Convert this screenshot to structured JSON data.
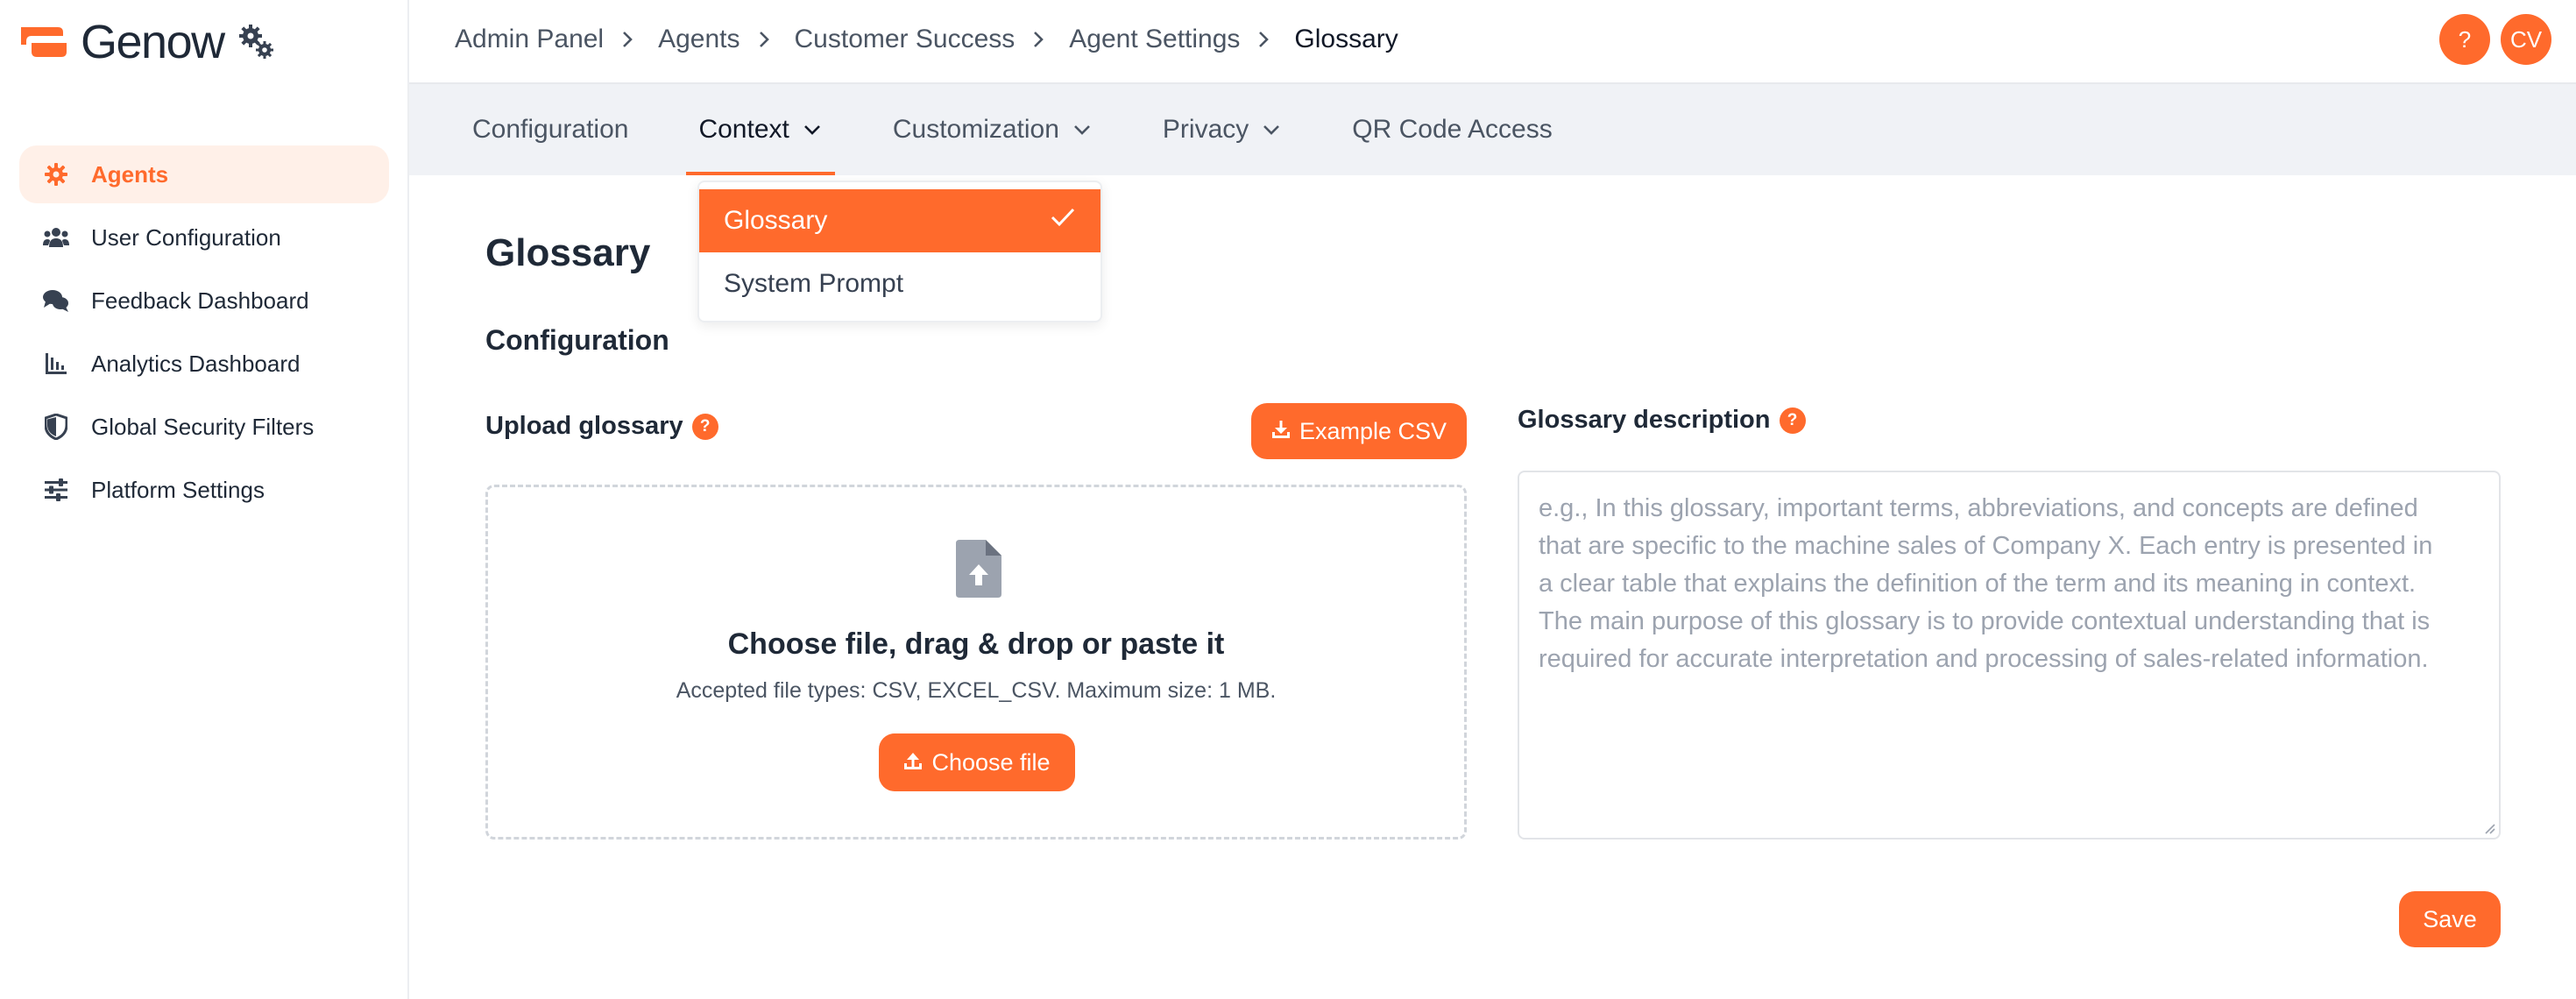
{
  "app": {
    "name": "Genow"
  },
  "sidebar": {
    "items": [
      {
        "label": "Agents",
        "icon": "gear-icon",
        "active": true
      },
      {
        "label": "User Configuration",
        "icon": "users-icon",
        "active": false
      },
      {
        "label": "Feedback Dashboard",
        "icon": "chat-bubbles-icon",
        "active": false
      },
      {
        "label": "Analytics Dashboard",
        "icon": "bar-chart-icon",
        "active": false
      },
      {
        "label": "Global Security Filters",
        "icon": "shield-icon",
        "active": false
      },
      {
        "label": "Platform Settings",
        "icon": "sliders-icon",
        "active": false
      }
    ]
  },
  "breadcrumb": [
    "Admin Panel",
    "Agents",
    "Customer Success",
    "Agent Settings",
    "Glossary"
  ],
  "header": {
    "help_label": "?",
    "avatar_initials": "CV"
  },
  "tabs": [
    {
      "label": "Configuration",
      "has_dropdown": false,
      "active": false
    },
    {
      "label": "Context",
      "has_dropdown": true,
      "active": true
    },
    {
      "label": "Customization",
      "has_dropdown": true,
      "active": false
    },
    {
      "label": "Privacy",
      "has_dropdown": true,
      "active": false
    },
    {
      "label": "QR Code Access",
      "has_dropdown": false,
      "active": false
    }
  ],
  "context_menu": {
    "items": [
      {
        "label": "Glossary",
        "selected": true
      },
      {
        "label": "System Prompt",
        "selected": false
      }
    ]
  },
  "main": {
    "title": "Glossary",
    "section_title": "Configuration",
    "upload": {
      "label": "Upload glossary",
      "help": "?",
      "example_button": "Example CSV",
      "drop_title": "Choose file, drag & drop or paste it",
      "drop_hint": "Accepted file types: CSV, EXCEL_CSV. Maximum size: 1 MB.",
      "choose_button": "Choose file"
    },
    "description": {
      "label": "Glossary description",
      "help": "?",
      "placeholder_lines": [
        "e.g., In this glossary, important terms, abbreviations, and concepts are defined",
        "that are specific to the machine sales of Company X. Each entry is presented in",
        "a clear table that explains the definition of the term and its meaning in context.",
        "The main purpose of this glossary is to provide contextual understanding that is",
        "required for accurate interpretation and processing of sales-related information."
      ],
      "value": ""
    },
    "save_button": "Save"
  },
  "colors": {
    "accent": "#ff6a2c",
    "tabbar_bg": "#f0f2f6",
    "active_nav_bg": "#fff0e8"
  }
}
